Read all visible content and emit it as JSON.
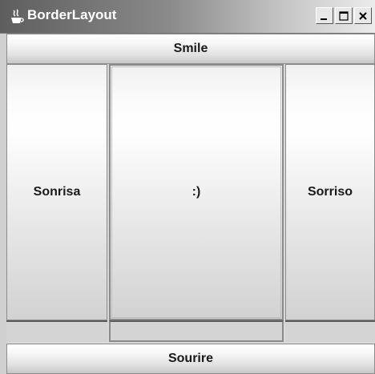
{
  "window": {
    "title": "BorderLayout",
    "title_icon": "java-cup-icon",
    "controls": [
      "minimize-icon",
      "maximize-icon",
      "close-icon"
    ]
  },
  "buttons": {
    "north": "Smile",
    "west": "Sonrisa",
    "center": ":)",
    "east": "Sorriso",
    "south": "Sourire"
  }
}
